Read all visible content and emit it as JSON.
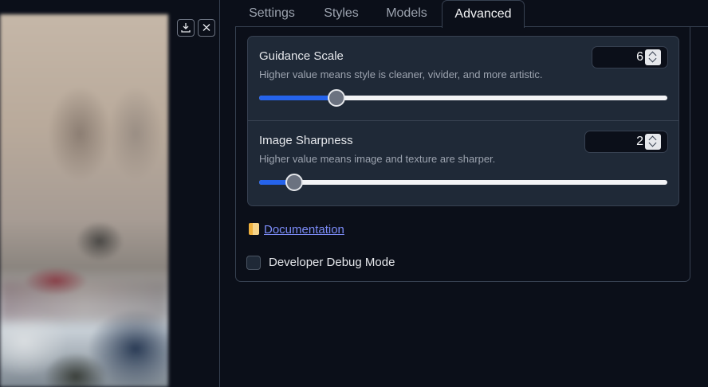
{
  "tabs": [
    {
      "label": "Settings",
      "active": false
    },
    {
      "label": "Styles",
      "active": false
    },
    {
      "label": "Models",
      "active": false
    },
    {
      "label": "Advanced",
      "active": true
    }
  ],
  "image_panel": {
    "download_icon": "download-icon",
    "close_icon": "close-icon"
  },
  "sliders": {
    "guidance": {
      "label": "Guidance Scale",
      "info": "Higher value means style is cleaner, vivider, and more artistic.",
      "value": "6",
      "fraction": 0.19
    },
    "sharpness": {
      "label": "Image Sharpness",
      "info": "Higher value means image and texture are sharper.",
      "value": "2",
      "fraction": 0.085
    }
  },
  "documentation": {
    "icon": "notebook-icon",
    "label": "Documentation"
  },
  "debug_mode": {
    "label": "Developer Debug Mode",
    "checked": false
  },
  "colors": {
    "background": "#0b0f19",
    "panel": "#1f2937",
    "accent": "#2563eb",
    "link": "#7c8cf8"
  }
}
